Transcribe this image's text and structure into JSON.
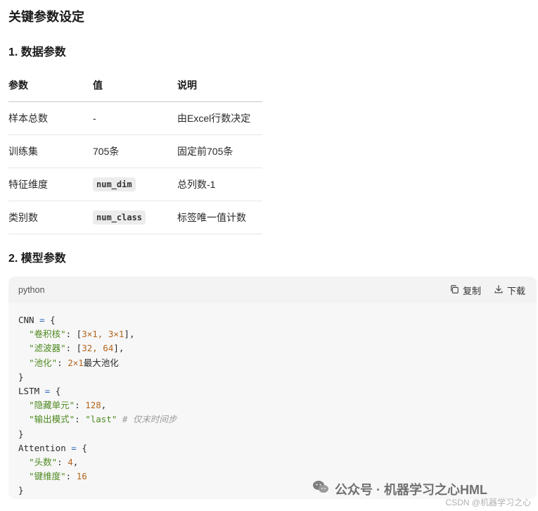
{
  "heading": "关键参数设定",
  "section1": {
    "title": "1. 数据参数",
    "headers": [
      "参数",
      "值",
      "说明"
    ],
    "rows": [
      {
        "param": "样本总数",
        "value": "-",
        "desc": "由Excel行数决定"
      },
      {
        "param": "训练集",
        "value": "705条",
        "desc": "固定前705条"
      },
      {
        "param": "特征维度",
        "value": "num_dim",
        "desc": "总列数-1"
      },
      {
        "param": "类别数",
        "value": "num_class",
        "desc": "标签唯一值计数"
      }
    ]
  },
  "section2": {
    "title": "2. 模型参数",
    "code": {
      "language": "python",
      "copy_label": "复制",
      "download_label": "下载",
      "cnn": {
        "name": "CNN",
        "k1": "\"卷积核\"",
        "v1": "3×1, 3×1",
        "k2": "\"滤波器\"",
        "v2": "32, 64",
        "k3": "\"池化\"",
        "v3_num": "2×1",
        "v3_text": "最大池化"
      },
      "lstm": {
        "name": "LSTM",
        "k1": "\"隐藏单元\"",
        "v1": "128",
        "k2": "\"输出模式\"",
        "v2": "\"last\"",
        "comment": "# 仅末时间步"
      },
      "attention": {
        "name": "Attention",
        "k1": "\"头数\"",
        "v1": "4",
        "k2": "\"键维度\"",
        "v2": "16"
      }
    }
  },
  "watermark": {
    "text": "公众号 · 机器学习之心HML",
    "icon": "wechat-icon"
  },
  "csdn": "CSDN @机器学习之心"
}
